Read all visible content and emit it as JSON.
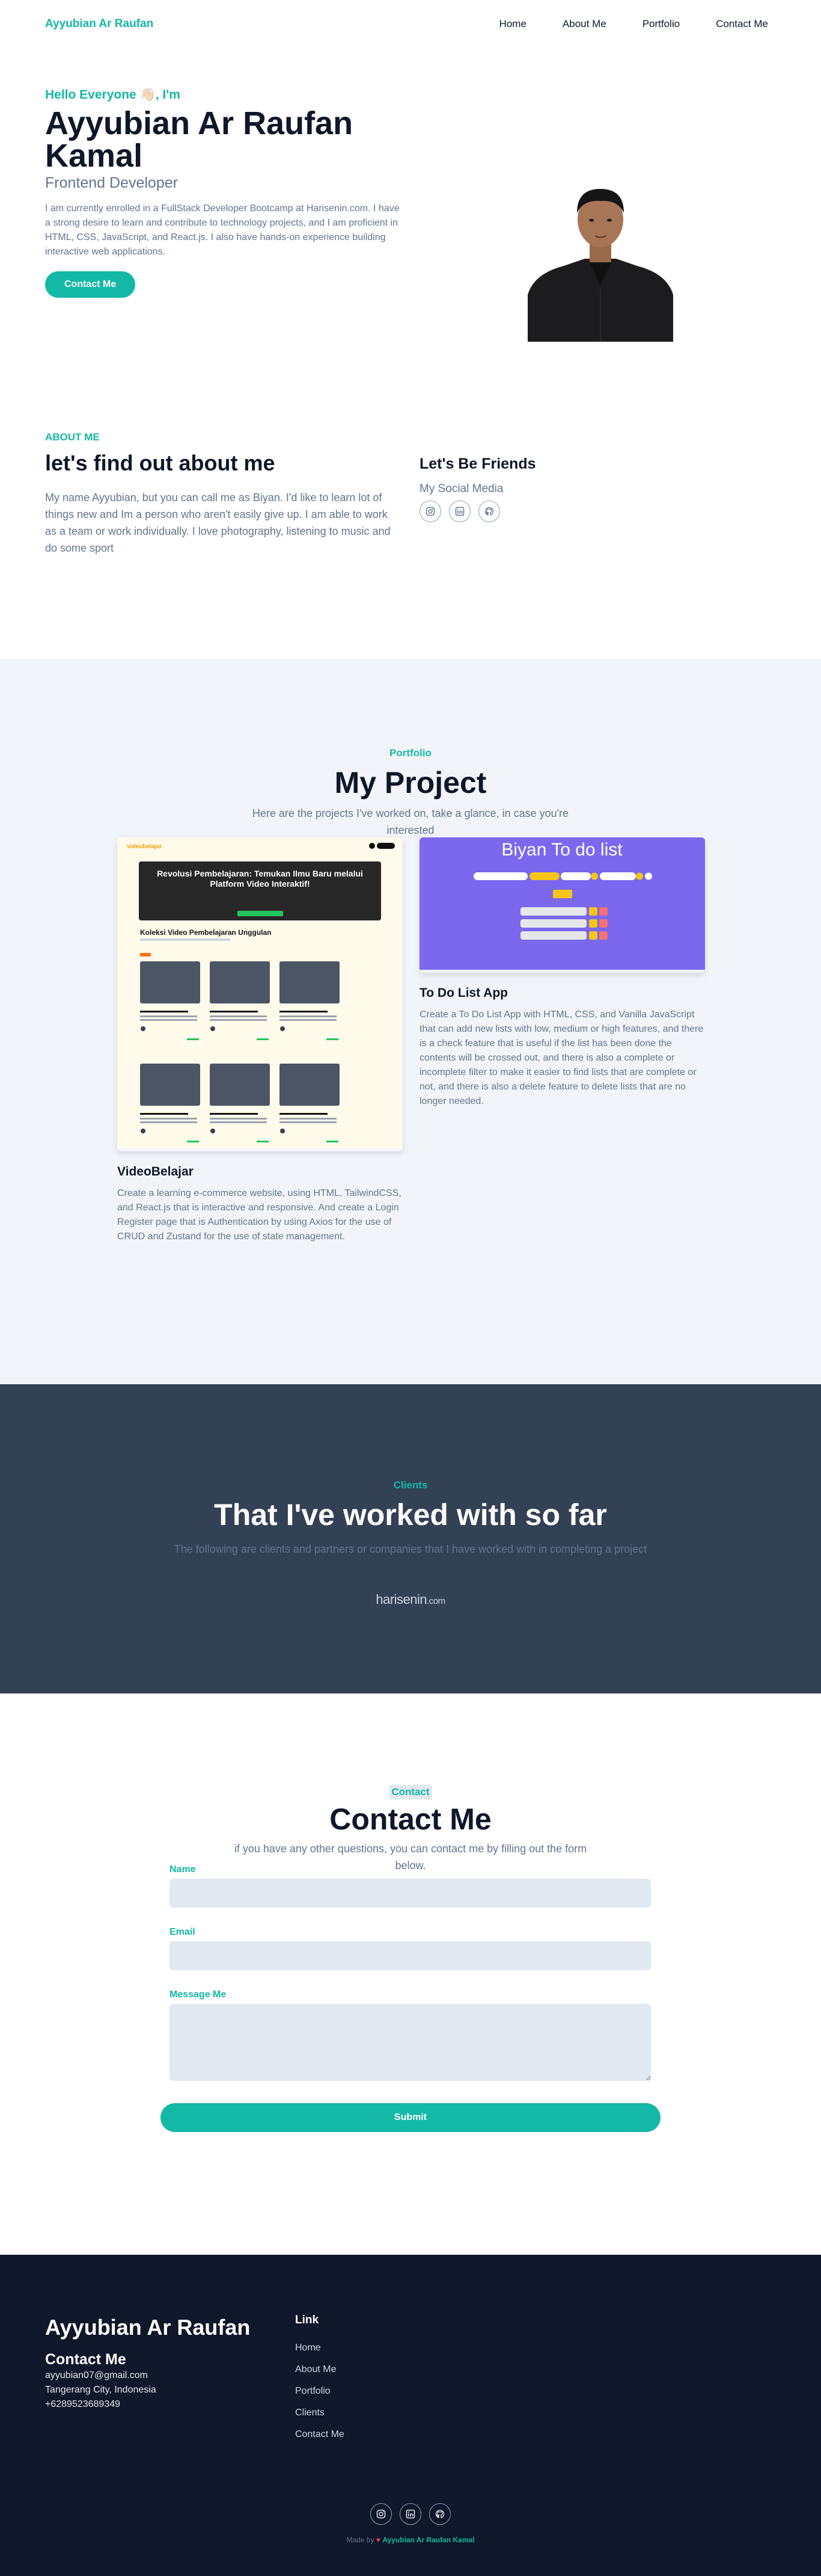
{
  "nav": {
    "brand": "Ayyubian Ar Raufan",
    "links": [
      "Home",
      "About Me",
      "Portfolio",
      "Contact Me"
    ]
  },
  "hero": {
    "greeting": "Hello Everyone 👋🏻, I'm",
    "name": "Ayyubian Ar Raufan Kamal",
    "role": "Frontend Developer",
    "description": "I am currently enrolled in a FullStack Developer Bootcamp at Harisenin.com. I have a strong desire to learn and contribute to technology projects, and I am proficient in HTML, CSS, JavaScript, and React.js. I also have hands-on experience building interactive web applications.",
    "cta": "Contact Me"
  },
  "about": {
    "tag": "ABOUT ME",
    "title": "let's find out about me",
    "text": "My name Ayyubian, but you can call me as Biyan. I'd like to learn lot of things new and Im a person who aren't easily give up. I am able to work as a team or work individually. I love photography, listening to music and do some sport",
    "friends_title": "Let's Be Friends",
    "social_label": "My Social Media"
  },
  "portfolio": {
    "tag": "Portfolio",
    "title": "My Project",
    "subtitle": "Here are the projects I've worked on, take a glance, in case you're interested",
    "projects": [
      {
        "title": "VideoBelajar",
        "description": "Create a learning e-commerce website, using HTML, TailwindCSS, and React.js that is interactive and responsive. And create a Login Register page that is Authentication by using Axios for the use of CRUD and Zustand for the use of state management."
      },
      {
        "title": "To Do List App",
        "description": "Create a To Do List App with HTML, CSS, and Vanilla JavaScript that can add new lists with low, medium or high features, and there is a check feature that is useful if the list has been done the contents will be crossed out, and there is also a complete or incomplete filter to make it easier to find lists that are complete or not, and there is also a delete feature to delete lists that are no longer needed."
      }
    ],
    "shot_vb": {
      "logo": "videobelajar",
      "banner_title": "Revolusi Pembelajaran: Temukan Ilmu Baru melalui Platform Video Interaktif!",
      "section_title": "Koleksi Video Pembelajaran Unggulan"
    },
    "shot_todo": {
      "title": "Biyan To do list"
    }
  },
  "clients": {
    "tag": "Clients",
    "title": "That I've worked with so far",
    "subtitle": "The following are clients and partners or companies that I have worked with in completing a project",
    "logo_main": "harisenin",
    "logo_suffix": ".com"
  },
  "contact": {
    "tag": "Contact",
    "title": "Contact Me",
    "subtitle": "if you have any other questions, you can contact me by filling out the form below.",
    "fields": {
      "name": "Name",
      "email": "Email",
      "message": "Message Me"
    },
    "submit": "Submit"
  },
  "footer": {
    "name": "Ayyubian Ar Raufan",
    "contact_title": "Contact Me",
    "email": "ayyubian07@gmail.com",
    "location": "Tangerang City, Indonesia",
    "phone": "+6289523689349",
    "links_title": "Link",
    "links": [
      "Home",
      "About Me",
      "Portfolio",
      "Clients",
      "Contact Me"
    ],
    "credit_prefix": "Made by",
    "credit_name": "Ayyubian Ar Raufan Kamal"
  },
  "colors": {
    "accent": "#14b8a6",
    "dark": "#0f172a",
    "slate": "#334155",
    "light_bg": "#f1f5f9"
  }
}
